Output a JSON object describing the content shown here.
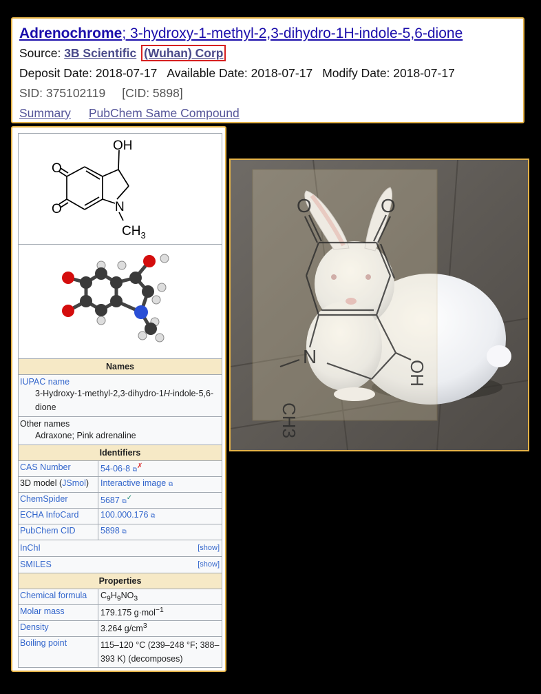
{
  "header": {
    "compound_name": "Adrenochrome",
    "iupac_title": "; 3-hydroxy-1-methyl-2,3-dihydro-1H-indole-5,6-dione",
    "source_label": "Source: ",
    "source_name_a": "3B Scientific",
    "source_name_b": "(Wuhan) Corp",
    "deposit_date": "Deposit Date: 2018-07-17",
    "available_date": "Available Date: 2018-07-17",
    "modify_date": "Modify Date: 2018-07-17",
    "sid": "SID: 375102119",
    "cid": "[CID: 5898]",
    "link_summary": "Summary",
    "link_same": "PubChem Same Compound"
  },
  "structure": {
    "atoms": {
      "o1": "O",
      "o2": "O",
      "oh": "OH",
      "n": "N",
      "ch": "CH",
      "sub3": "3"
    }
  },
  "infobox": {
    "names_header": "Names",
    "iupac_label": "IUPAC name",
    "iupac_value_a": "3-Hydroxy-1-methyl-2,3-dihydro-1",
    "iupac_value_h": "H",
    "iupac_value_b": "-indole-5,6-dione",
    "other_label": "Other names",
    "other_value": "Adraxone; Pink adrenaline",
    "identifiers_header": "Identifiers",
    "cas_label": "CAS Number",
    "cas_value": "54-06-8",
    "model_label_a": "3D model (",
    "model_label_link": "JSmol",
    "model_label_b": ")",
    "model_value": "Interactive image",
    "chemspider_label": "ChemSpider",
    "chemspider_value": "5687",
    "echa_label": "ECHA InfoCard",
    "echa_value": "100.000.176",
    "pubchem_label": "PubChem CID",
    "pubchem_value": "5898",
    "inchi_label": "InChI",
    "smiles_label": "SMILES",
    "show_label": "[show]",
    "properties_header": "Properties",
    "formula_label": "Chemical formula",
    "formula_c": "C",
    "formula_c_n": "9",
    "formula_h": "H",
    "formula_h_n": "9",
    "formula_no": "NO",
    "formula_o_n": "3",
    "molar_label": "Molar mass",
    "molar_value": "179.175 g·mol",
    "molar_exp": "−1",
    "density_label": "Density",
    "density_value": "3.264 g/cm",
    "density_exp": "3",
    "boiling_label": "Boiling point",
    "boiling_value": "115–120 °C (239–248 °F; 388–393 K) (decomposes)"
  },
  "photo": {
    "overlay_atoms": {
      "o_left": "O",
      "o_right": "O",
      "n": "N",
      "ch3": "CH3",
      "oh": "OH"
    }
  },
  "colors": {
    "accent_border": "#e5b348",
    "highlight_box": "#d62020",
    "link": "#3366cc",
    "section_bg": "#f6e9c6"
  }
}
